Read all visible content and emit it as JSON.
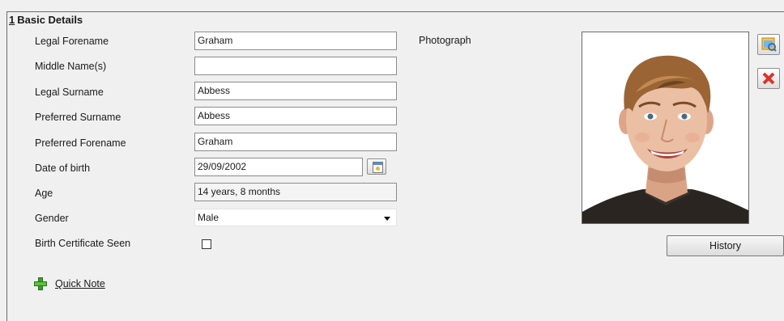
{
  "section": {
    "number": "1",
    "title": "Basic Details"
  },
  "fields": {
    "legal_forename": {
      "label": "Legal Forename",
      "value": "Graham"
    },
    "middle_names": {
      "label": "Middle Name(s)",
      "value": ""
    },
    "legal_surname": {
      "label": "Legal Surname",
      "value": "Abbess"
    },
    "preferred_surname": {
      "label": "Preferred Surname",
      "value": "Abbess"
    },
    "preferred_forename": {
      "label": "Preferred Forename",
      "value": "Graham"
    },
    "date_of_birth": {
      "label": "Date of birth",
      "value": "29/09/2002"
    },
    "age": {
      "label": "Age",
      "value": "14 years, 8 months"
    },
    "gender": {
      "label": "Gender",
      "value": "Male"
    },
    "birth_certificate": {
      "label": "Birth Certificate Seen",
      "checked": false
    }
  },
  "quick_note": {
    "label": "Quick Note",
    "icon": "add-icon"
  },
  "photograph": {
    "label": "Photograph",
    "browse_icon": "browse-photo-icon",
    "remove_icon": "delete-photo-icon",
    "history_label": "History"
  }
}
